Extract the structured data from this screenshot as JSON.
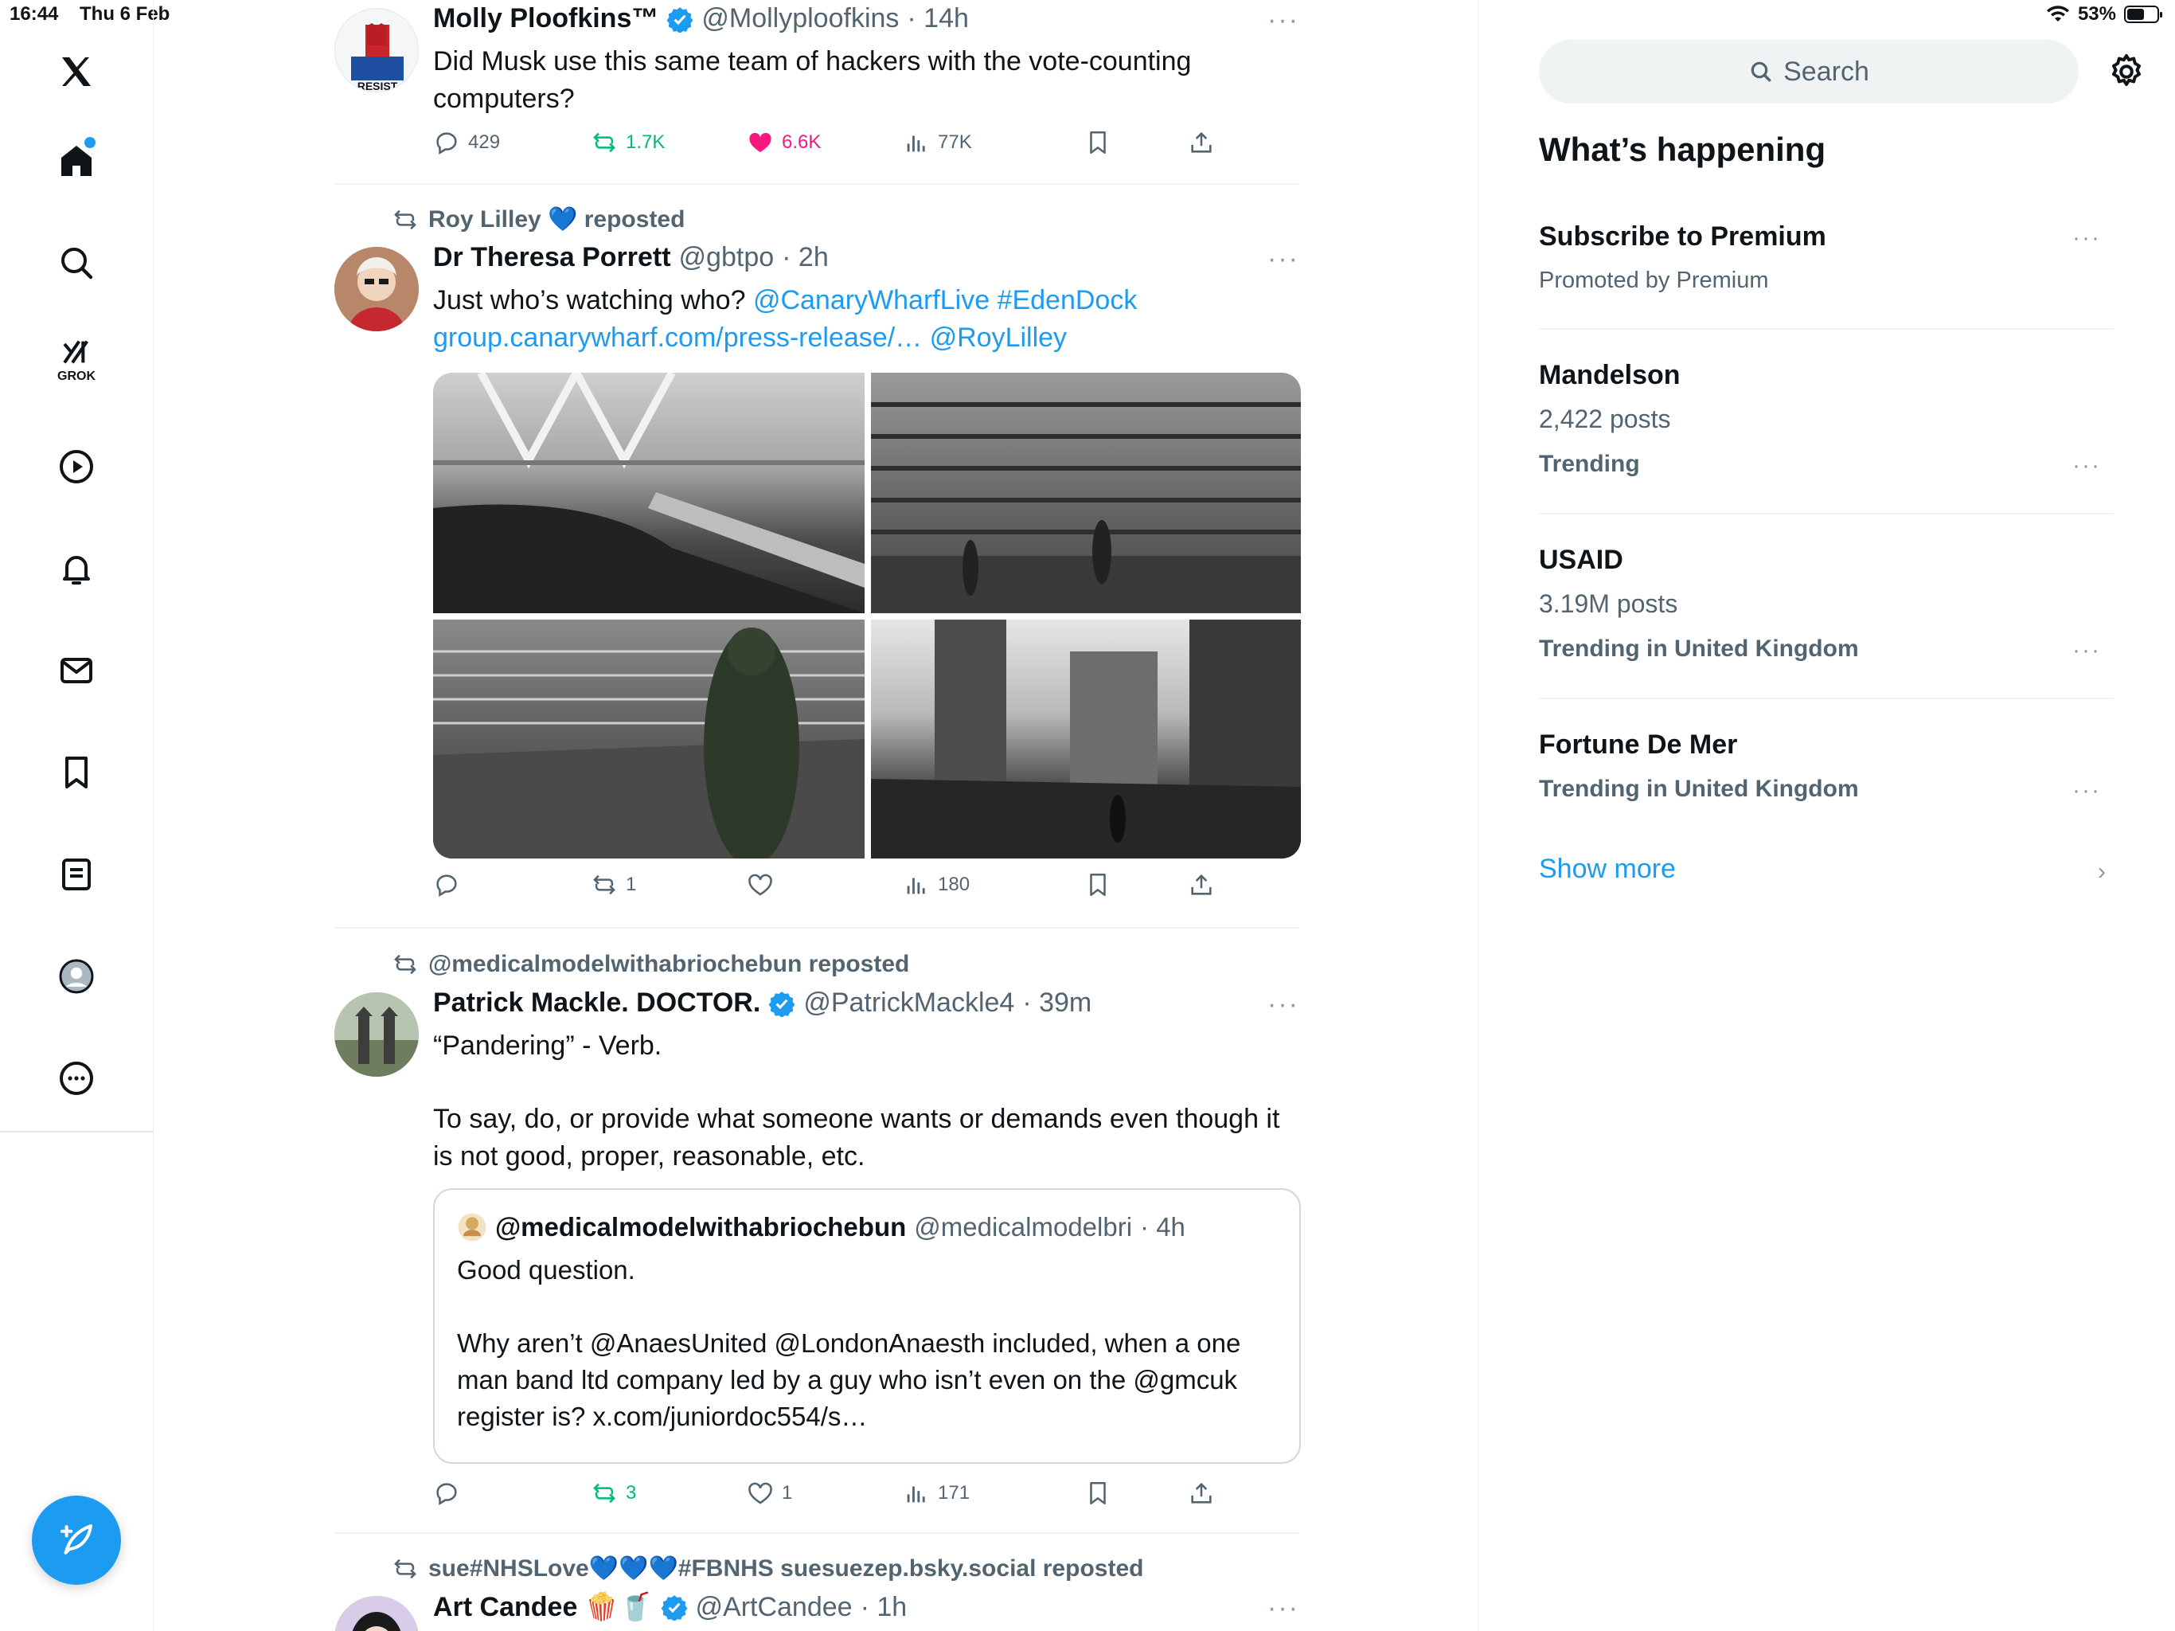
{
  "status": {
    "time": "16:44",
    "date": "Thu 6 Feb",
    "battery": "53%",
    "battery_level": 0.53
  },
  "nav": {
    "items": [
      {
        "name": "x-logo-icon"
      },
      {
        "name": "home-icon"
      },
      {
        "name": "search-icon"
      },
      {
        "name": "grok-icon",
        "label": "GROK"
      },
      {
        "name": "video-icon"
      },
      {
        "name": "notifications-icon"
      },
      {
        "name": "messages-icon"
      },
      {
        "name": "bookmarks-icon"
      },
      {
        "name": "lists-icon"
      },
      {
        "name": "profile-icon"
      },
      {
        "name": "more-icon"
      }
    ],
    "compose_icon": "compose-icon"
  },
  "feed": {
    "tweets": [
      {
        "name": "Molly Ploofkins™",
        "handle": "@Mollyploofkins",
        "time": "· 14h",
        "verified": true,
        "avatar_text": "RESIST",
        "text": "Did Musk use this same team of hackers with the vote-counting computers?",
        "replies": "429",
        "reposts": "1.7K",
        "likes": "6.6K",
        "views": "77K"
      },
      {
        "repost_by": "Roy Lilley 💙 reposted",
        "name": "Dr Theresa Porrett",
        "handle": "@gbtpo",
        "time": "· 2h",
        "text_plain": "Just who’s watching who? ",
        "link1": "@CanaryWharfLive #EdenDock",
        "link2": "group.canarywharf.com/press-release/… @RoyLilley",
        "replies": "",
        "reposts": "1",
        "likes": "",
        "views": "180"
      },
      {
        "repost_by": "@medicalmodelwithabriochebun reposted",
        "name": "Patrick Mackle. DOCTOR.",
        "handle": "@PatrickMackle4",
        "time": "· 39m",
        "verified": true,
        "line1": "“Pandering” - Verb.",
        "line2": "To say, do, or provide what someone wants or demands even though it is not good, proper, reasonable, etc.",
        "quote": {
          "name": "@medicalmodelwithabriochebun",
          "handle": "@medicalmodelbri",
          "time": "· 4h",
          "line1": "Good question.",
          "line2": "Why aren’t @AnaesUnited @LondonAnaesth included,  when a one man band ltd company led by a guy who isn’t even on the @gmcuk register is? x.com/juniordoc554/s…"
        },
        "replies": "",
        "reposts": "3",
        "likes": "1",
        "views": "171"
      },
      {
        "repost_by": "sue#NHSLove💙💙💙#FBNHS suesuezep.bsky.social reposted",
        "name": "Art Candee 🍿🥤",
        "handle": "@ArtCandee",
        "time": "· 1h",
        "verified": true
      }
    ]
  },
  "sidebar": {
    "search_placeholder": "Search",
    "title": "What’s happening",
    "trends": [
      {
        "name": "Subscribe to Premium",
        "sub": "Promoted by Premium"
      },
      {
        "name": "Mandelson",
        "sub": "2,422 posts",
        "context": "Trending"
      },
      {
        "name": "USAID",
        "sub": "3.19M posts",
        "context": "Trending in United Kingdom"
      },
      {
        "name": "Fortune De Mer",
        "context": "Trending in United Kingdom"
      }
    ],
    "show_more": "Show more",
    "more_glyph": "···"
  },
  "colors": {
    "accent": "#1d9bf0",
    "repost_green": "#00ba7c",
    "like_pink": "#f91880",
    "muted": "#536471"
  }
}
